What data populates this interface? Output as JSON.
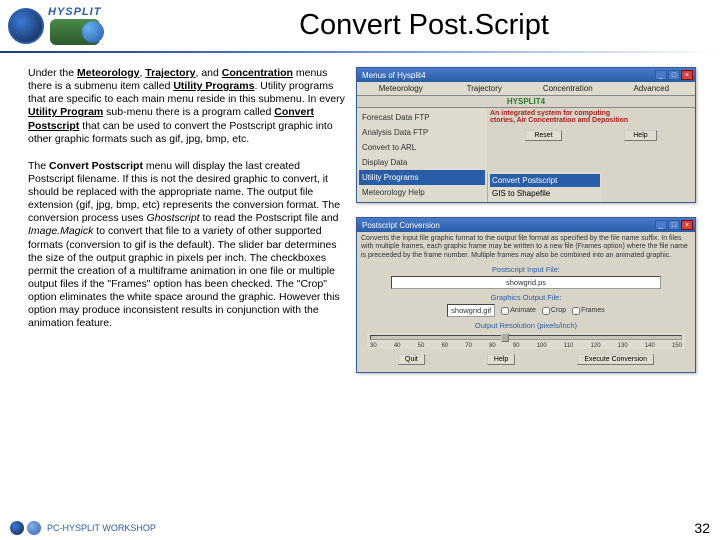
{
  "header": {
    "hysplit_label": "HYSPLIT",
    "title": "Convert Post.Script"
  },
  "paragraphs": {
    "p1_a": "Under the ",
    "p1_b": "Meteorology",
    "p1_c": ", ",
    "p1_d": "Trajectory",
    "p1_e": ", and ",
    "p1_f": "Concentration",
    "p1_g": " menus there is a submenu item called ",
    "p1_h": "Utility Programs",
    "p1_i": ". Utility programs that are specific to each main menu reside in this submenu. In every ",
    "p1_j": "Utility Program",
    "p1_k": " sub-menu there is a program called ",
    "p1_l": "Convert Postscript",
    "p1_m": " that can be used to convert the Postscript graphic into other graphic formats such as gif, jpg, bmp, etc.",
    "p2_a": "The ",
    "p2_b": "Convert Postscript",
    "p2_c": " menu will display the last created Postscript filename. If this is not the desired graphic to convert, it should be replaced with the appropriate name. The output file extension (gif, jpg, bmp, etc) represents the conversion format. The conversion process uses ",
    "p2_d": "Ghostscript",
    "p2_e": " to read the Postscript file and ",
    "p2_f": "Image.Magick",
    "p2_g": " to convert that file to a variety of other supported formats (conversion to gif is the default). The slider bar determines the size of the output graphic in pixels per inch. The checkboxes permit the creation of a multiframe animation in one file or multiple output files if the \"Frames\" option has been checked. The \"Crop\" option eliminates the white space around the graphic. However this option may produce inconsistent results in conjunction with the animation feature."
  },
  "win1": {
    "title": "Menus of Hysplit4",
    "menubar": [
      "Meteorology",
      "Trajectory",
      "Concentration",
      "Advanced"
    ],
    "hys_title": "HYSPLIT4",
    "desc_line1": "An integrated system for computing",
    "desc_line2": "ctories, Air Concentration and Deposition",
    "btn_reset": "Reset",
    "btn_help": "Help",
    "left_items": [
      "Forecast Data FTP",
      "Analysis Data FTP",
      "Convert to ARL",
      "Display Data"
    ],
    "left_highlight": "Utility Programs",
    "left_after": "Meteorology Help",
    "sub_highlight": "Convert Postscript",
    "sub_after": "GIS to Shapefile"
  },
  "win2": {
    "title": "Postscript Conversion",
    "desc": "Converts the input file graphic format to the output file format as specified by the file name suffix. In files with multiple frames, each graphic frame may be written to a new file (Frames option) where the file name is preceeded by the frame number. Multiple frames may also be combined into an animated graphic.",
    "input_label": "Postscript Input File:",
    "input_value": "showgrid.ps",
    "output_label": "Graphics Output File:",
    "output_value": "showgrid.gif",
    "cb_animate": "Animate",
    "cb_crop": "Crop",
    "cb_frames": "Frames",
    "res_label": "Output Resolution (pixels/inch)",
    "ticks": [
      "30",
      "40",
      "50",
      "60",
      "70",
      "80",
      "90",
      "100",
      "110",
      "120",
      "130",
      "140",
      "150"
    ],
    "btn_quit": "Quit",
    "btn_help": "Help",
    "btn_exec": "Execute Conversion"
  },
  "footer": {
    "text": "PC-HYSPLIT WORKSHOP",
    "page": "32"
  }
}
